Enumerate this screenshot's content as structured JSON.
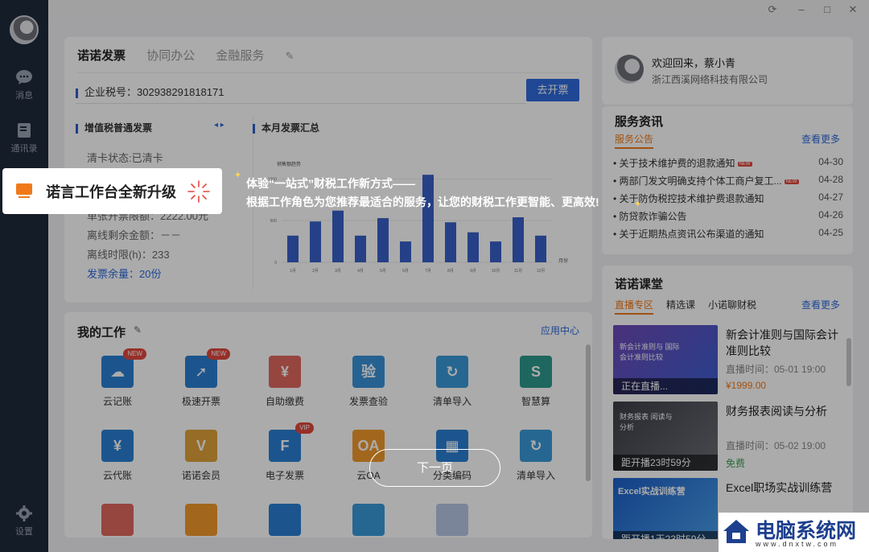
{
  "sidebar": {
    "items": [
      {
        "label": "消息",
        "icon": "chat-icon"
      },
      {
        "label": "通讯录",
        "icon": "contacts-icon"
      }
    ],
    "settings_label": "设置"
  },
  "tabs": [
    "诺诺发票",
    "协同办公",
    "金融服务"
  ],
  "tax": {
    "label": "企业税号：",
    "value": "302938291818171",
    "button": "去开票"
  },
  "invoice_card": {
    "title": "增值税普通发票",
    "status": "清卡状态:已清卡",
    "quota": "单张开票限额：2222.00元",
    "offline_remaining": "离线剩余金额：－－",
    "offline_hours": "离线时限(h)：233",
    "remaining": "发票余量：20份"
  },
  "monthly": {
    "title": "本月发票汇总"
  },
  "chart_data": {
    "type": "bar",
    "title": "销售额趋势",
    "xlabel": "月份",
    "categories": [
      "1月",
      "2月",
      "3月",
      "4月",
      "5月",
      "6月",
      "7月",
      "8月",
      "9月",
      "10月",
      "11月",
      "12月"
    ],
    "values": [
      320,
      490,
      620,
      320,
      530,
      250,
      1050,
      480,
      360,
      250,
      540,
      320
    ],
    "ylim": [
      0,
      1000
    ],
    "yticks": [
      "0",
      "500",
      "1000"
    ]
  },
  "work": {
    "title": "我的工作",
    "center": "应用中心",
    "apps": [
      {
        "label": "云记账",
        "icon": "cloud-ledger-icon",
        "color": "#2a7fd4",
        "badge": "NEW"
      },
      {
        "label": "极速开票",
        "icon": "rocket-invoice-icon",
        "color": "#2a7fd4",
        "badge": "NEW"
      },
      {
        "label": "自助缴费",
        "icon": "yuan-cycle-icon",
        "color": "#e0675f",
        "badge": ""
      },
      {
        "label": "发票查验",
        "icon": "shield-check-icon",
        "color": "#3a93d8",
        "badge": ""
      },
      {
        "label": "清单导入",
        "icon": "import-icon",
        "color": "#3a9ad8",
        "badge": ""
      },
      {
        "label": "智慧算",
        "icon": "smart-calc-icon",
        "color": "#2e9a8c",
        "badge": ""
      },
      {
        "label": "云代账",
        "icon": "cloud-yuan-icon",
        "color": "#2a7fd4",
        "badge": ""
      },
      {
        "label": "诺诺会员",
        "icon": "member-v-icon",
        "color": "#e0a23a",
        "badge": ""
      },
      {
        "label": "电子发票",
        "icon": "e-invoice-icon",
        "color": "#2a7fd4",
        "badge": "VIP"
      },
      {
        "label": "云OA",
        "icon": "cloud-oa-icon",
        "color": "#f29a2c",
        "badge": ""
      },
      {
        "label": "分类编码",
        "icon": "qr-code-icon",
        "color": "#2a7fd4",
        "badge": ""
      },
      {
        "label": "清单导入",
        "icon": "import-icon",
        "color": "#3a9ad8",
        "badge": ""
      }
    ]
  },
  "user": {
    "welcome": "欢迎回来，蔡小青",
    "company": "浙江西溪网络科技有限公司"
  },
  "service": {
    "title": "服务资讯",
    "tab": "服务公告",
    "more": "查看更多",
    "items": [
      {
        "text": "关于技术维护费的退款通知",
        "date": "04-30",
        "badge": "NEW"
      },
      {
        "text": "两部门发文明确支持个体工商户复工...",
        "date": "04-28",
        "badge": "NEW"
      },
      {
        "text": "关于防伪税控技术维护费退款通知",
        "date": "04-27",
        "badge": ""
      },
      {
        "text": "防贷款诈骗公告",
        "date": "04-26",
        "badge": ""
      },
      {
        "text": "关于近期热点资讯公布渠道的通知",
        "date": "04-25",
        "badge": ""
      }
    ]
  },
  "class": {
    "title": "诺诺课堂",
    "tabs": [
      "直播专区",
      "精选课",
      "小诺聊财税"
    ],
    "more": "查看更多",
    "courses": [
      {
        "title": "新会计准则与国际会计准则比较",
        "time": "直播时间：05-01 19:00",
        "price": "¥1999.00",
        "cap": "正在直播...",
        "thumb": "新会计准则与 国际会计准则比较"
      },
      {
        "title": "财务报表阅读与分析",
        "time": "直播时间：05-02 19:00",
        "price": "免费",
        "cap": "距开播23时59分",
        "thumb": "财务报表 阅读与分析"
      },
      {
        "title": "Excel职场实战训练营",
        "time": "",
        "price": "",
        "cap": "距开播1天23时59分",
        "thumb": "Excel实战训练营"
      }
    ]
  },
  "guide": {
    "title": "诺言工作台全新升级",
    "line1": "体验“一站式”财税工作新方式——",
    "line2": "根据工作角色为您推荐最适合的服务，让您的财税工作更智能、更高效!",
    "next": "下一页"
  },
  "watermark": {
    "name": "电脑系统网",
    "url": "www.dnxtw.com"
  }
}
